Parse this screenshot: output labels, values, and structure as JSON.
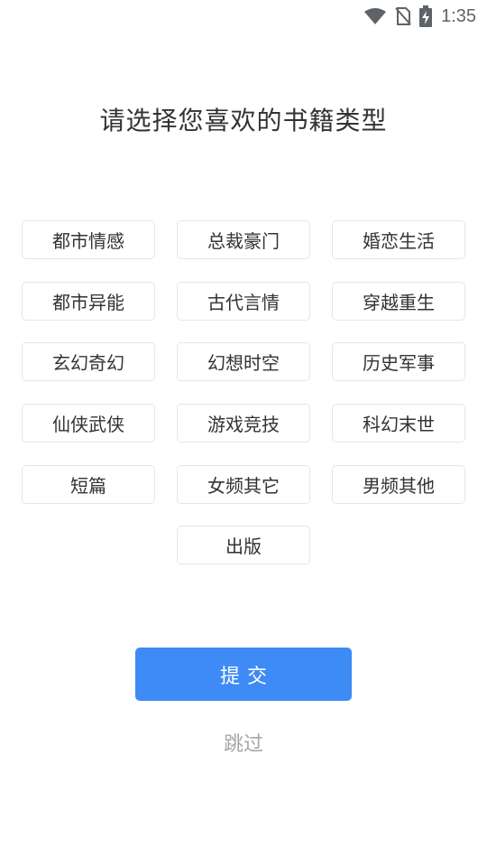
{
  "status_bar": {
    "time": "1:35",
    "icons": [
      "wifi-icon",
      "no-sim-icon",
      "battery-charging-icon"
    ]
  },
  "page": {
    "title": "请选择您喜欢的书籍类型"
  },
  "categories": [
    "都市情感",
    "总裁豪门",
    "婚恋生活",
    "都市异能",
    "古代言情",
    "穿越重生",
    "玄幻奇幻",
    "幻想时空",
    "历史军事",
    "仙侠武侠",
    "游戏竞技",
    "科幻末世",
    "短篇",
    "女频其它",
    "男频其他",
    "出版"
  ],
  "actions": {
    "submit_label": "提交",
    "skip_label": "跳过"
  },
  "colors": {
    "accent": "#3e8bf6",
    "border": "#e6e6e6",
    "text": "#333333",
    "muted": "#a6a6a6"
  }
}
